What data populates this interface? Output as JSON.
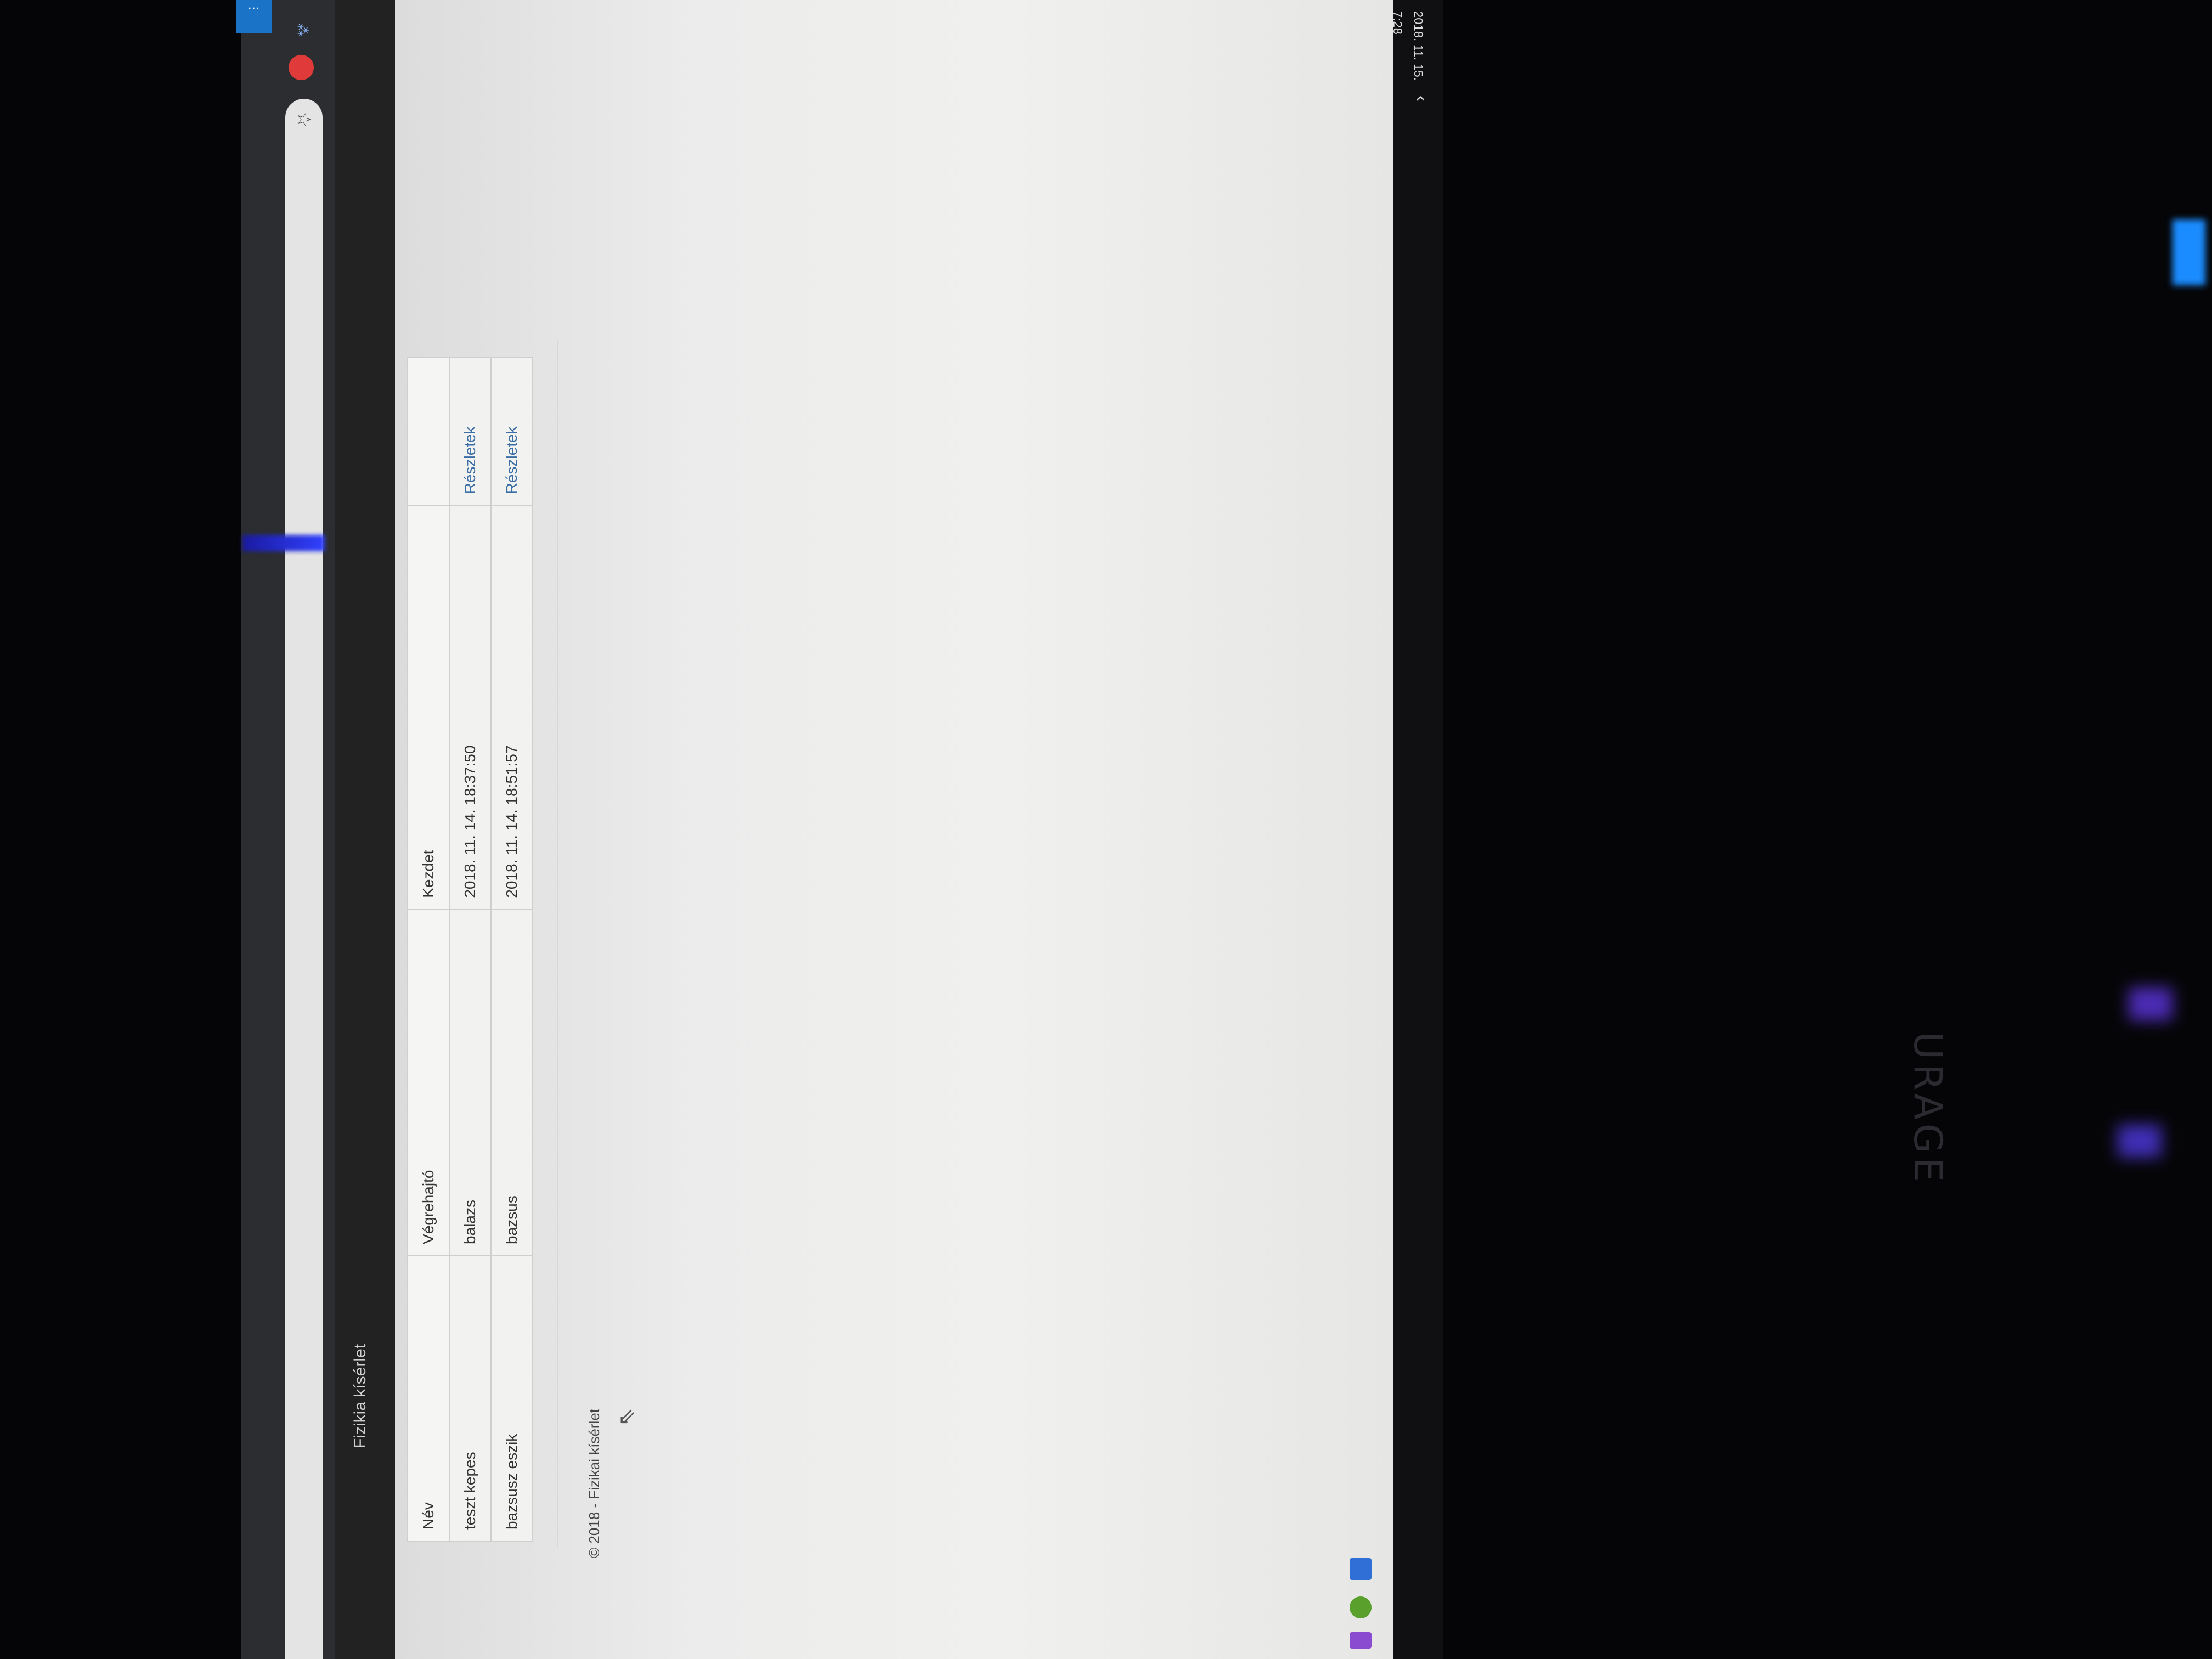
{
  "browser": {
    "bookmark_icon": "star-icon",
    "stop_icon": "stop-icon",
    "extension_icon": "extension-icon",
    "menu_glyph": "⋯"
  },
  "navbar": {
    "brand": "Fizikia kísérlet"
  },
  "table": {
    "headers": [
      "Név",
      "Végrehajtó",
      "Kezdet",
      ""
    ],
    "rows": [
      {
        "name": "teszt kepes",
        "executor": "balazs",
        "start": "2018. 11. 14. 18:37:50",
        "action": "Részletek"
      },
      {
        "name": "bazsusz eszik",
        "executor": "bazsus",
        "start": "2018. 11. 14. 18:51:57",
        "action": "Részletek"
      }
    ]
  },
  "footer": {
    "text": "© 2018 - Fizikai kísérlet"
  },
  "taskbar": {
    "time": "7:28",
    "date": "2018. 11. 15.",
    "chevron": "‹"
  },
  "keyboard": {
    "brand": "URAGE"
  }
}
